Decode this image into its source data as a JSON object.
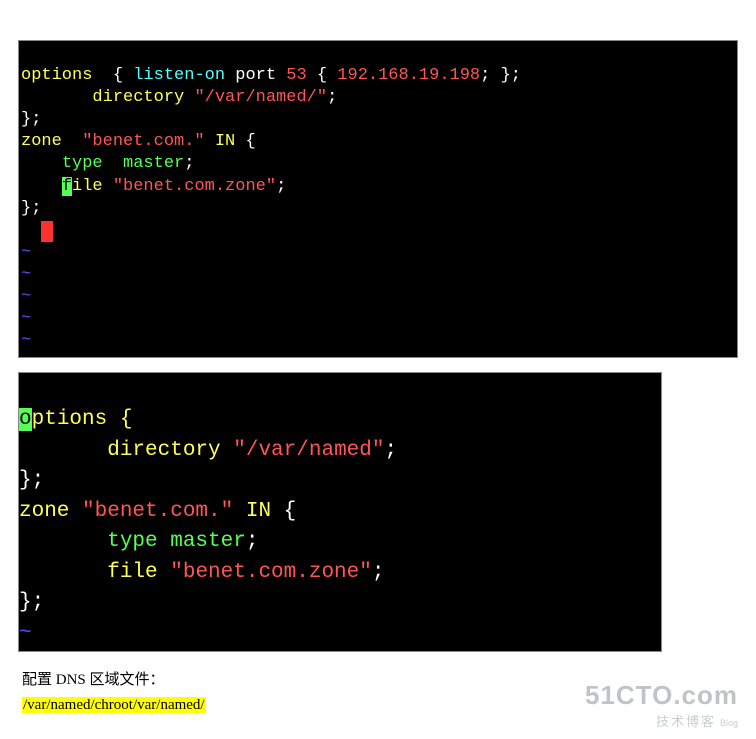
{
  "terminal1": {
    "l1": {
      "a": "options ",
      "b": " { ",
      "c": "listen-on",
      "d": " port ",
      "e": "53",
      "f": " { ",
      "g": "192.168.19.198",
      "h": "; };"
    },
    "l2": {
      "a": "       directory ",
      "b": "\"/var/named/\"",
      "c": ";"
    },
    "l3": "};",
    "l4": {
      "a": "zone  ",
      "b": "\"benet.com.\"",
      "c": " IN ",
      "d": "{"
    },
    "l5": {
      "a": "    ",
      "b": "type  master",
      "c": ";"
    },
    "l6": {
      "a": "    ",
      "cursor": "f",
      "b": "ile ",
      "c": "\"benet.com.zone\"",
      "d": ";"
    },
    "l7": "};",
    "blockCursor": " ",
    "tilde": "~"
  },
  "terminal2": {
    "l1": {
      "cursor": "o",
      "a": "ptions {"
    },
    "l2": {
      "a": "       directory ",
      "b": "\"/var/named\"",
      "c": ";"
    },
    "l3": "};",
    "l4": {
      "a": "zone ",
      "b": "\"benet.com.\"",
      "c": " IN ",
      "d": "{"
    },
    "l5": {
      "a": "       ",
      "b": "type master",
      "c": ";"
    },
    "l6": {
      "a": "       file ",
      "b": "\"benet.com.zone\"",
      "c": ";"
    },
    "l7": "};",
    "tilde": "~"
  },
  "caption": {
    "line1": "配置 DNS 区域文件：",
    "line2": "/var/named/chroot/var/named/"
  },
  "watermark": {
    "top": "51CTO.com",
    "bottom": "技术博客",
    "blog": "Blog"
  }
}
